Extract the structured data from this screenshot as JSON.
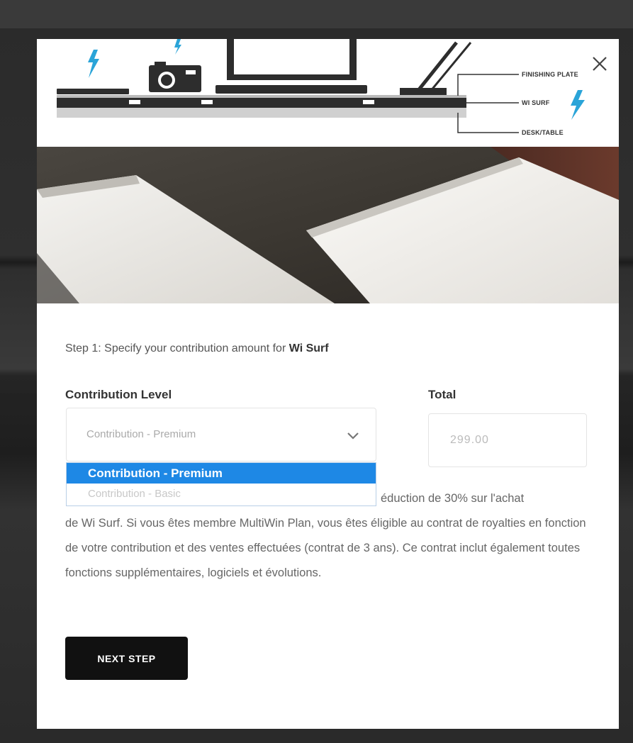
{
  "diagram": {
    "label_finishing_plate": "FINISHING PLATE",
    "label_wi_surf": "WI SURF",
    "label_desk_table": "DESK/TABLE"
  },
  "step": {
    "prefix": "Step 1: Specify your contribution amount for ",
    "product": "Wi Surf"
  },
  "contribution": {
    "label": "Contribution Level",
    "selected_value": "Contribution - Premium",
    "options": [
      {
        "label": "Contribution - Premium",
        "selected": true
      },
      {
        "label": "Contribution - Basic",
        "selected": false
      }
    ]
  },
  "total": {
    "label": "Total",
    "value": "299.00"
  },
  "description": {
    "line1_visible": "éduction de 30% sur l'achat",
    "rest": "de Wi Surf. Si vous êtes membre MultiWin Plan, vous êtes éligible au contrat de royalties en fonction de votre contribution et des ventes effectuées (contrat de 3 ans). Ce contrat inclut également toutes fonctions supplémentaires, logiciels et évolutions."
  },
  "next_button": {
    "label": "NEXT STEP"
  },
  "colors": {
    "accent_blue": "#1e88e5",
    "bolt_blue": "#2aa4d8",
    "button_bg": "#111111"
  },
  "icons": {
    "close": "close-icon",
    "chevron": "chevron-down-icon",
    "bolt": "lightning-bolt-icon",
    "camera": "camera-icon"
  }
}
